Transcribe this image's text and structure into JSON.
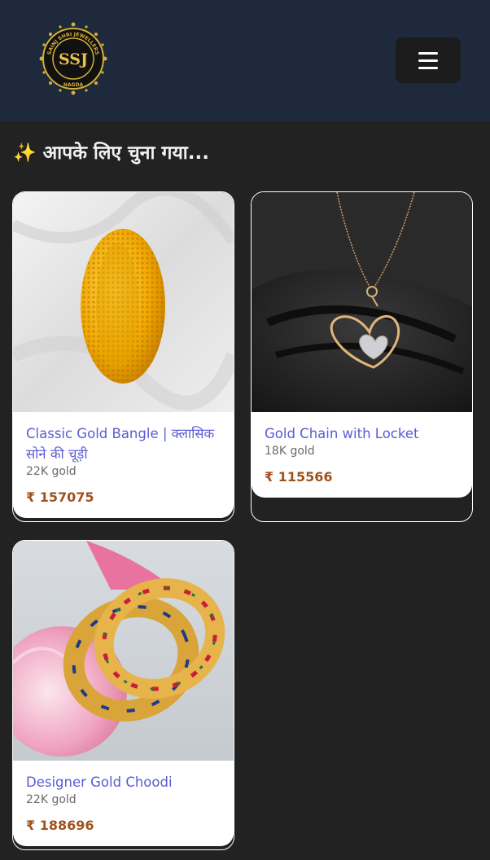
{
  "header": {
    "logo_monogram": "SSJ",
    "logo_ring_text": "SAINJ SHRI JEWELLERS",
    "logo_place": "NAGDA",
    "menu_icon": "hamburger-icon"
  },
  "section": {
    "title": "✨ आपके लिए चुना गया..."
  },
  "products": [
    {
      "name": "Classic Gold Bangle | क्लासिक सोने की चूड़ी",
      "purity": "22K gold",
      "price": "₹ 157075",
      "image_icon": "gold-bangle-image"
    },
    {
      "name": "Gold Chain with Locket",
      "purity": "18K gold",
      "price": "₹ 115566",
      "image_icon": "heart-locket-image"
    },
    {
      "name": "Designer Gold Choodi",
      "purity": "22K gold",
      "price": "₹ 188696",
      "image_icon": "meenakari-bangles-image"
    }
  ],
  "colors": {
    "header_bg": "#1e293b",
    "page_bg": "#222222",
    "product_name": "#5b5bd6",
    "price": "#a0521d",
    "gold": "#d4af37"
  }
}
